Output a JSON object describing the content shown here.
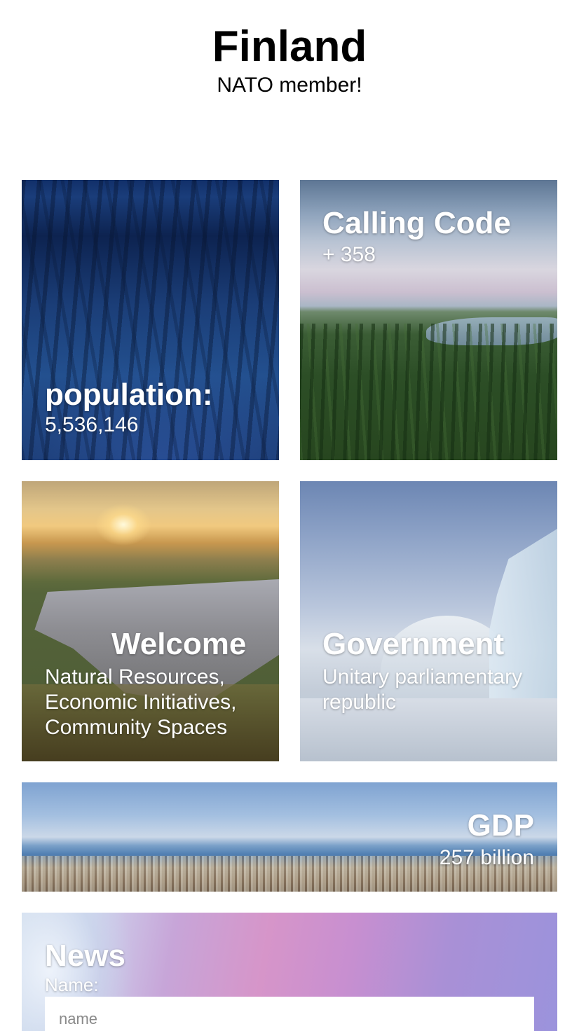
{
  "header": {
    "title": "Finland",
    "subtitle": "NATO member!"
  },
  "cards": {
    "population": {
      "heading": "population:",
      "value": "5,536,146"
    },
    "calling_code": {
      "heading": "Calling Code",
      "value": "+ 358"
    },
    "welcome": {
      "heading": "Welcome",
      "value": "Natural Resources, Economic Initiatives, Community Spaces"
    },
    "government": {
      "heading": "Government",
      "value": "Unitary parliamentary republic"
    },
    "gdp": {
      "heading": "GDP",
      "value": "257 billion"
    },
    "news": {
      "heading": "News",
      "name_label": "Name:",
      "name_placeholder": "name",
      "name_value": ""
    }
  }
}
